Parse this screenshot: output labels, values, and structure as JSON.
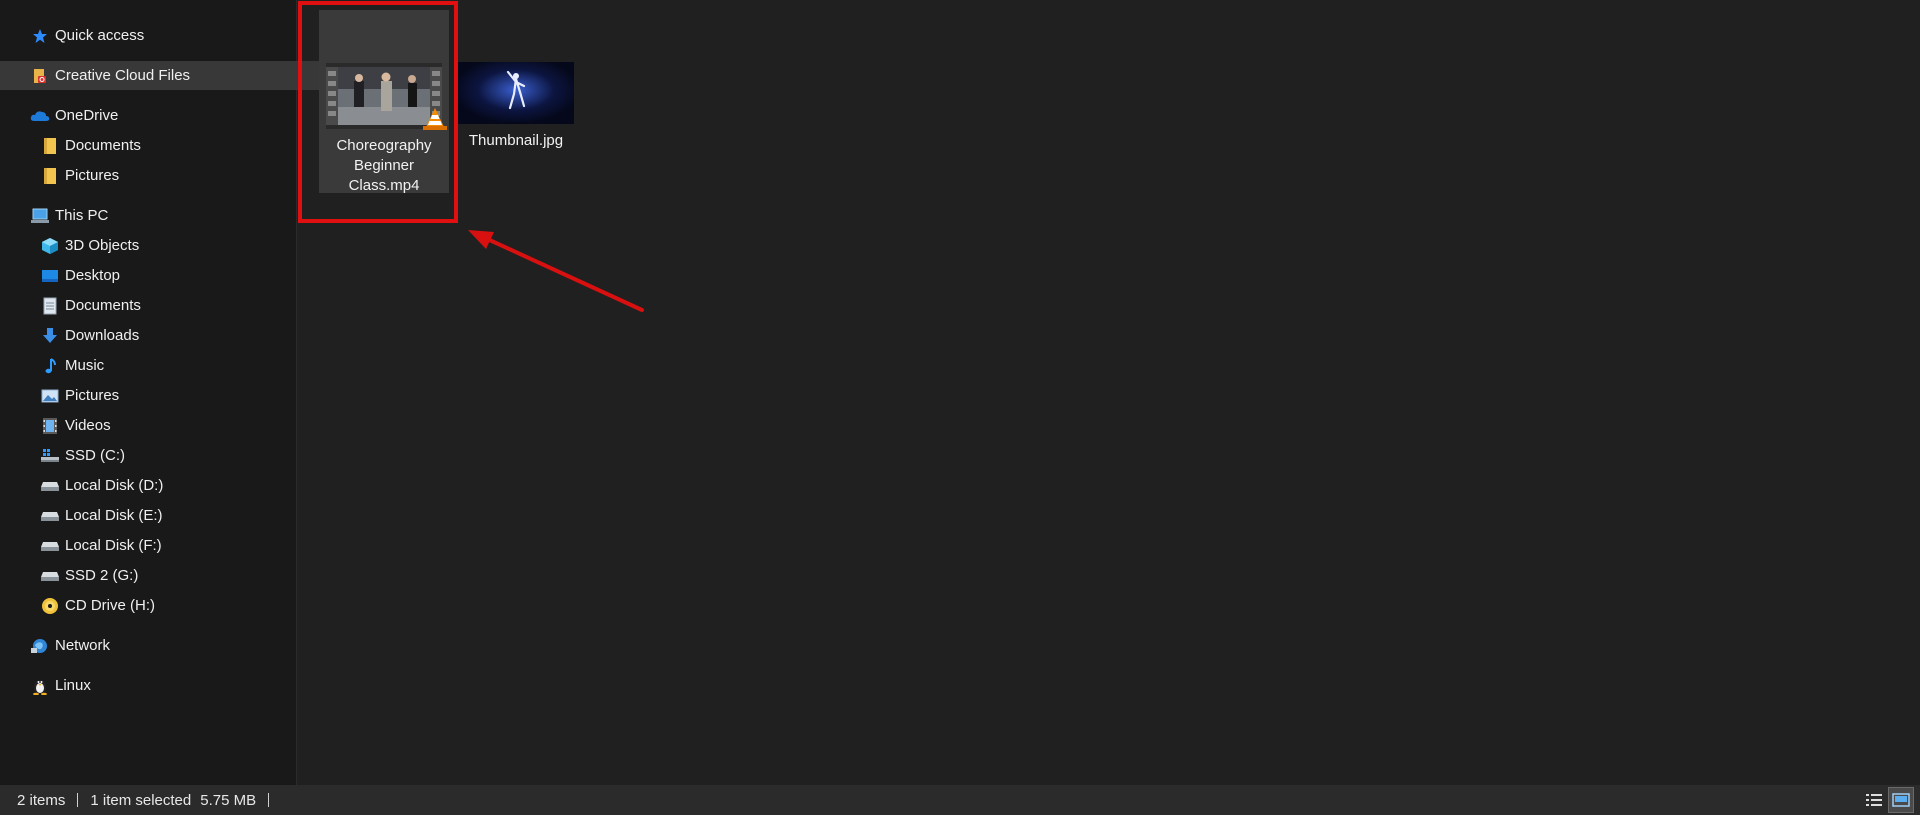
{
  "sidebar": {
    "items": [
      {
        "label": "Quick access",
        "icon": "star-icon"
      },
      {
        "label": "Creative Cloud Files",
        "icon": "creative-cloud-folder-icon"
      },
      {
        "label": "OneDrive",
        "icon": "onedrive-cloud-icon"
      },
      {
        "label": "Documents",
        "icon": "folder-icon"
      },
      {
        "label": "Pictures",
        "icon": "folder-icon"
      },
      {
        "label": "This PC",
        "icon": "computer-icon"
      },
      {
        "label": "3D Objects",
        "icon": "3d-objects-icon"
      },
      {
        "label": "Desktop",
        "icon": "desktop-icon"
      },
      {
        "label": "Documents",
        "icon": "documents-icon"
      },
      {
        "label": "Downloads",
        "icon": "download-arrow-icon"
      },
      {
        "label": "Music",
        "icon": "music-note-icon"
      },
      {
        "label": "Pictures",
        "icon": "pictures-icon"
      },
      {
        "label": "Videos",
        "icon": "film-icon"
      },
      {
        "label": "SSD (C:)",
        "icon": "windows-drive-icon"
      },
      {
        "label": "Local Disk (D:)",
        "icon": "drive-icon"
      },
      {
        "label": "Local Disk (E:)",
        "icon": "drive-icon"
      },
      {
        "label": "Local Disk (F:)",
        "icon": "drive-icon"
      },
      {
        "label": "SSD 2 (G:)",
        "icon": "drive-icon"
      },
      {
        "label": "CD Drive (H:)",
        "icon": "cd-drive-icon"
      },
      {
        "label": "Network",
        "icon": "network-icon"
      },
      {
        "label": "Linux",
        "icon": "linux-penguin-icon"
      }
    ]
  },
  "files": [
    {
      "name": "Choreography Beginner Class.mp4",
      "name_lines": [
        "Choreography",
        "Beginner",
        "Class.mp4"
      ],
      "selected": true,
      "overlay_icon": "vlc-cone-icon"
    },
    {
      "name": "Thumbnail.jpg",
      "name_lines": [
        "Thumbnail.jpg"
      ],
      "selected": false
    }
  ],
  "status": {
    "item_count": "2 items",
    "selection": "1 item selected",
    "size": "5.75 MB"
  },
  "colors": {
    "background": "#202020",
    "sidebar": "#191919",
    "selected": "#383838",
    "annotation": "#e01010",
    "accent": "#0a84ff"
  }
}
